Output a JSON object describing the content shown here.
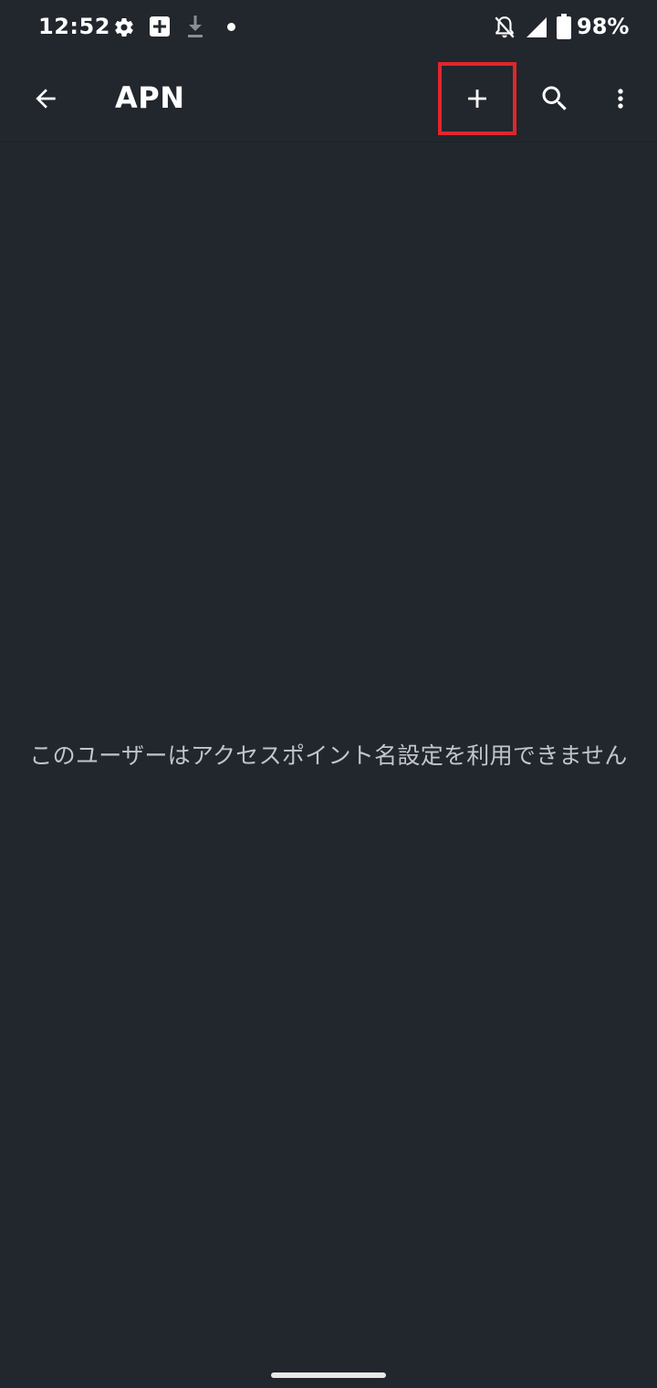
{
  "status_bar": {
    "time": "12:52",
    "battery": "98%",
    "icons": [
      "gear-icon",
      "plus-box-icon",
      "download-icon",
      "dot-icon",
      "bell-off-icon",
      "signal-icon",
      "battery-icon"
    ]
  },
  "app_bar": {
    "title": "APN",
    "icons": [
      "back-arrow-icon",
      "plus-icon",
      "search-icon",
      "more-vert-icon"
    ],
    "highlight_color": "#e0262c"
  },
  "main": {
    "message": "このユーザーはアクセスポイント名設定を利用できません"
  },
  "colors": {
    "background": "#22262d",
    "text_primary": "#ffffff",
    "text_secondary": "#c2c5ca"
  }
}
